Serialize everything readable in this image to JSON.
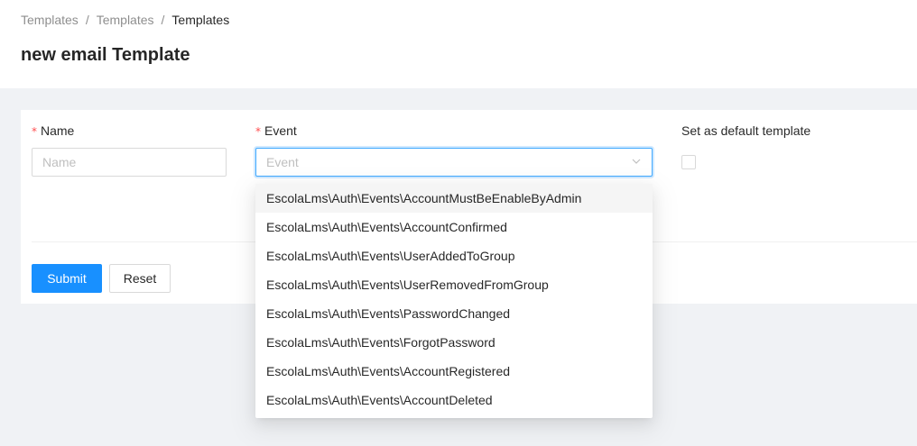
{
  "breadcrumb": {
    "items": [
      "Templates",
      "Templates",
      "Templates"
    ],
    "separator": "/"
  },
  "page_title": "new email Template",
  "form": {
    "name": {
      "label": "Name",
      "required_mark": "*",
      "placeholder": "Name",
      "value": ""
    },
    "event": {
      "label": "Event",
      "required_mark": "*",
      "placeholder": "Event",
      "expanded": true,
      "options": [
        "EscolaLms\\Auth\\Events\\AccountMustBeEnableByAdmin",
        "EscolaLms\\Auth\\Events\\AccountConfirmed",
        "EscolaLms\\Auth\\Events\\UserAddedToGroup",
        "EscolaLms\\Auth\\Events\\UserRemovedFromGroup",
        "EscolaLms\\Auth\\Events\\PasswordChanged",
        "EscolaLms\\Auth\\Events\\ForgotPassword",
        "EscolaLms\\Auth\\Events\\AccountRegistered",
        "EscolaLms\\Auth\\Events\\AccountDeleted"
      ],
      "active_option_index": 0
    },
    "default_template": {
      "label": "Set as default template",
      "checked": false
    },
    "submit_label": "Submit",
    "reset_label": "Reset"
  },
  "icons": {
    "event_select": "chevron-down-icon"
  },
  "colors": {
    "primary": "#1890ff",
    "required": "#ff4d4f",
    "focus_border": "#40a9ff"
  }
}
